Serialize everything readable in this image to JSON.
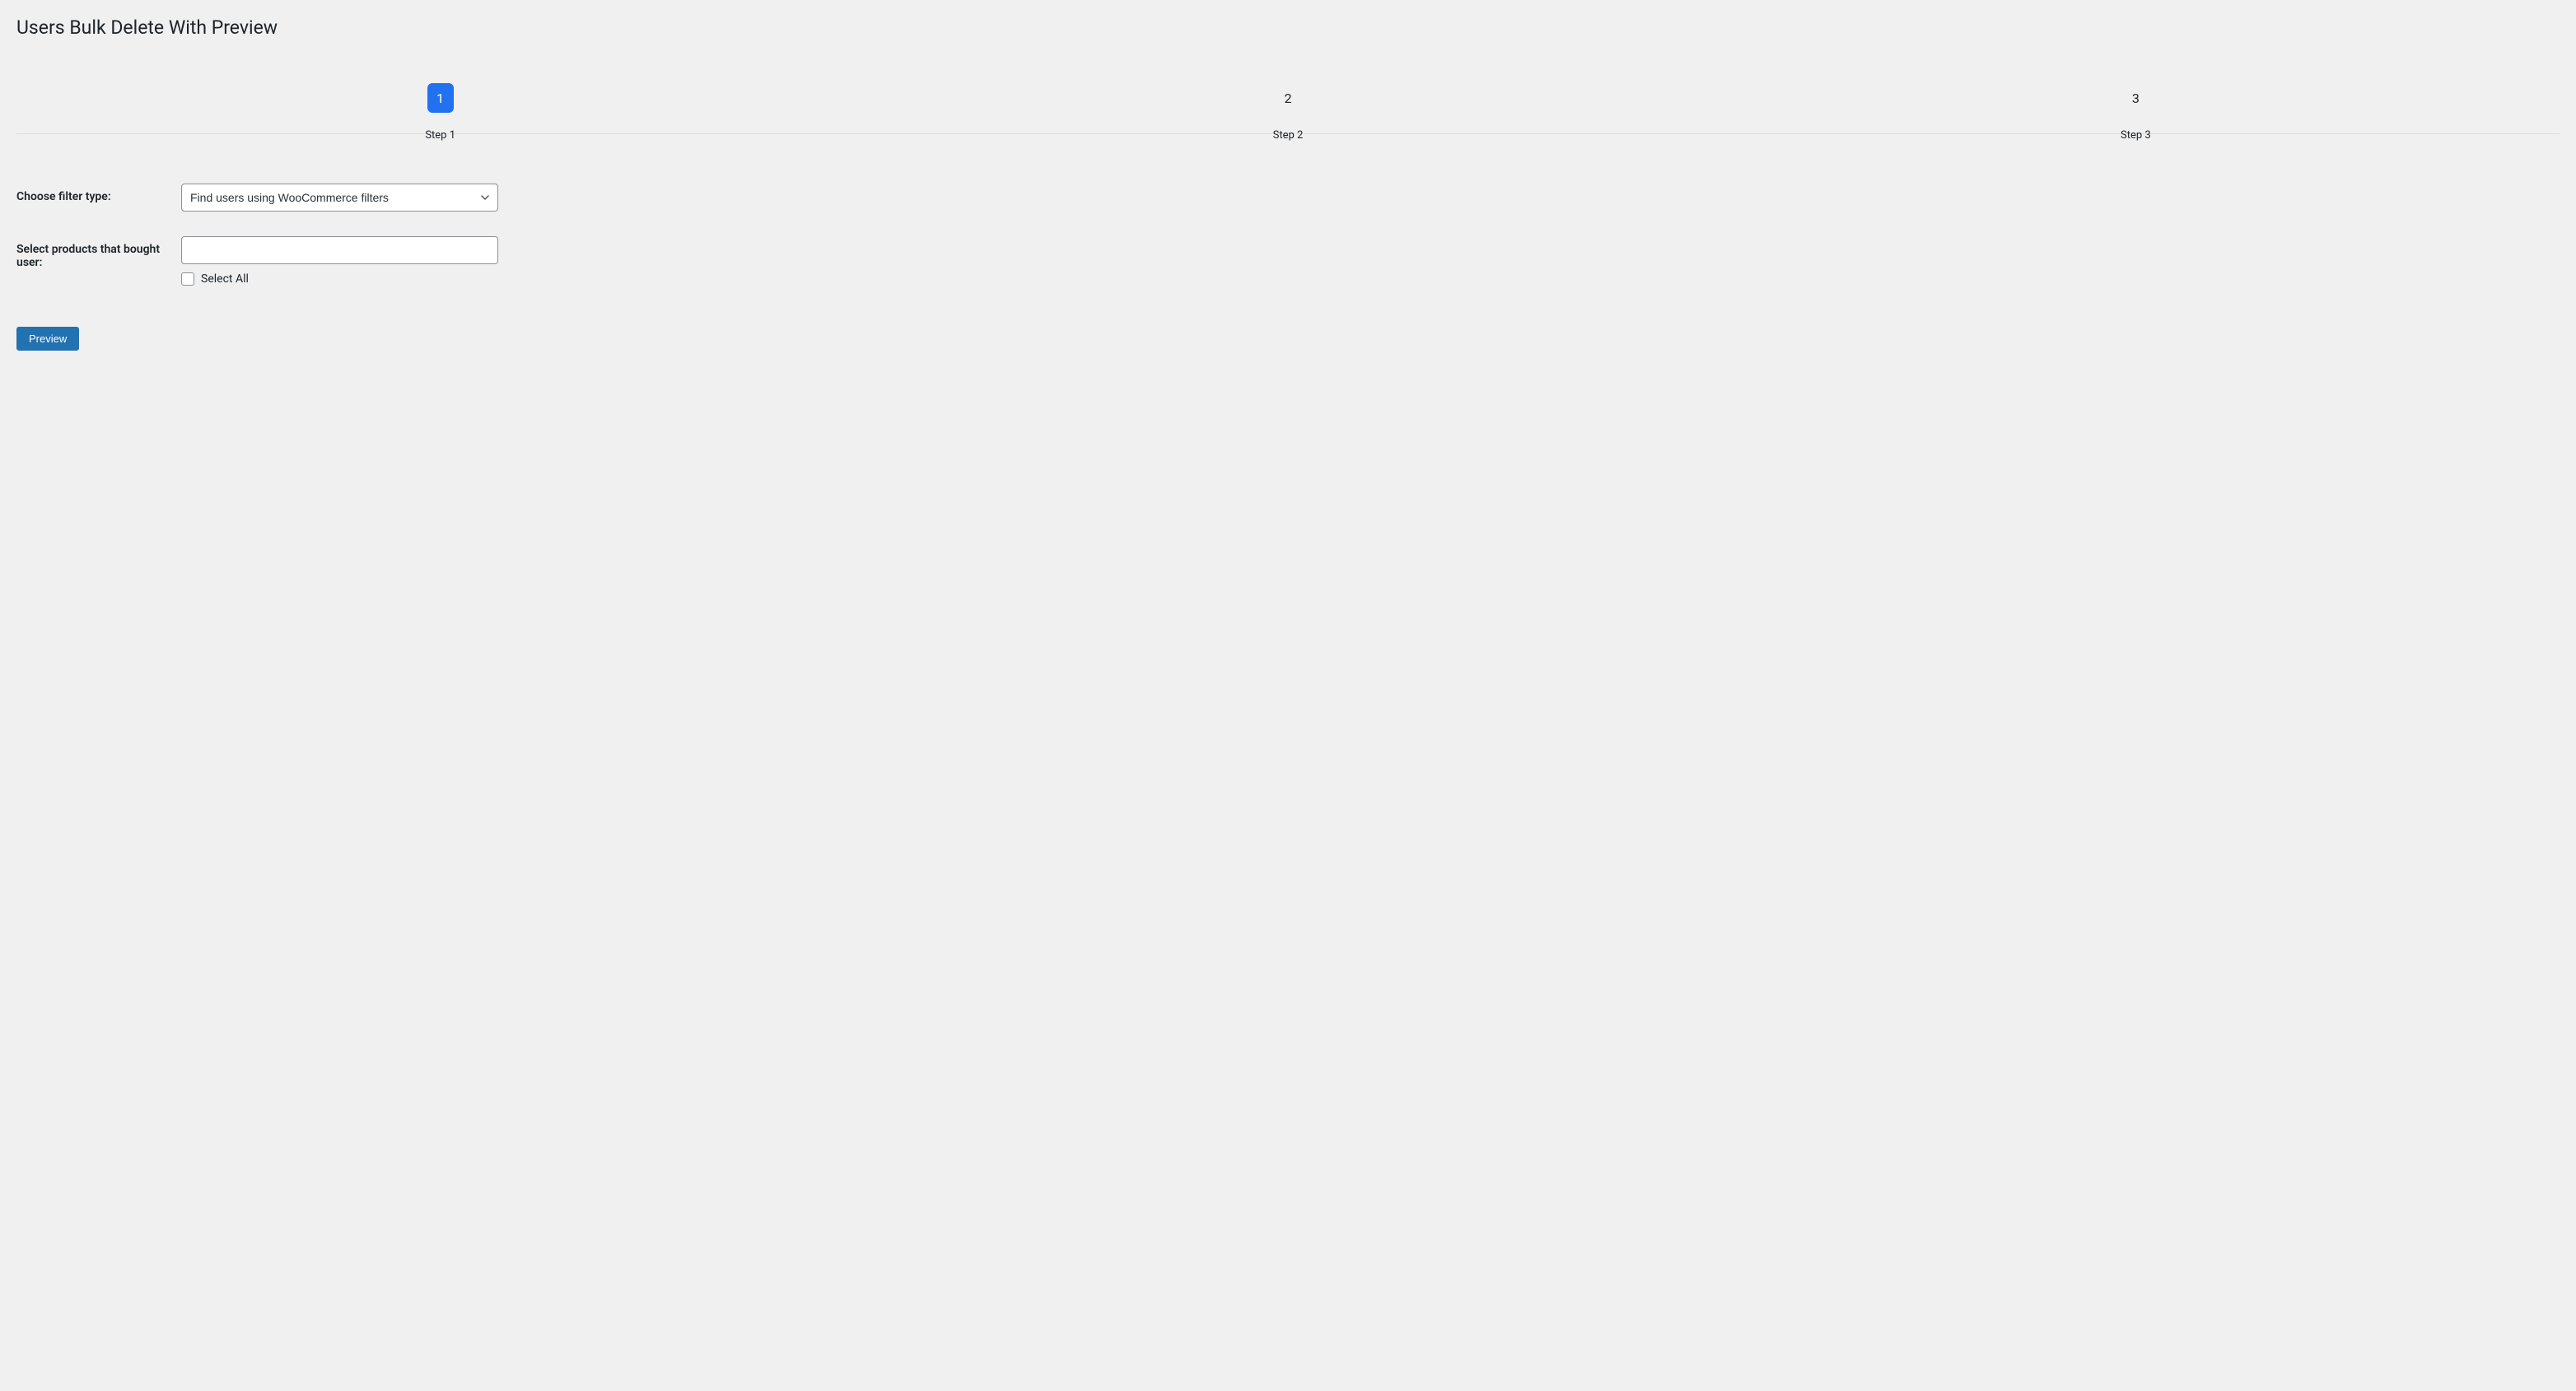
{
  "page": {
    "title": "Users Bulk Delete With Preview"
  },
  "stepper": {
    "steps": [
      {
        "number": "1",
        "label": "Step 1",
        "active": true
      },
      {
        "number": "2",
        "label": "Step 2",
        "active": false
      },
      {
        "number": "3",
        "label": "Step 3",
        "active": false
      }
    ]
  },
  "form": {
    "filter_type_label": "Choose filter type:",
    "filter_type_value": "Find users using WooCommerce filters",
    "products_label": "Select products that bought user:",
    "products_value": "",
    "select_all_label": "Select All",
    "preview_button": "Preview"
  }
}
